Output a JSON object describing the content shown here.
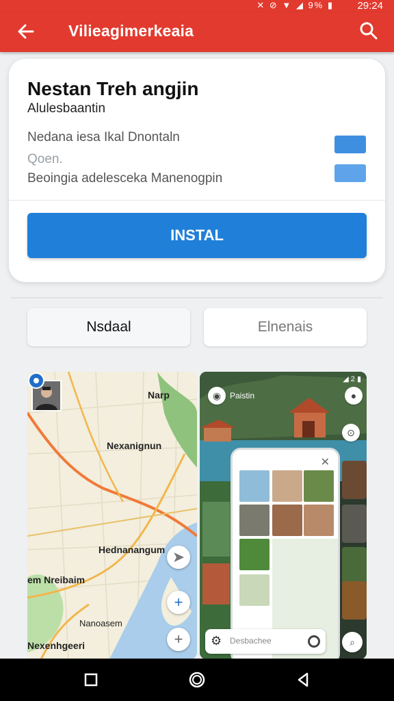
{
  "status": {
    "time": "29:24",
    "icons": "✕ ⊘ ▼ ◢ 9% ▮"
  },
  "appbar": {
    "title": "Vilieagimerkeaia",
    "back_icon": "arrow-left-icon",
    "search_icon": "search-icon"
  },
  "card": {
    "title": "Nestan Treh angjin",
    "subtitle": "Alulesbaantin",
    "rows": [
      "Nedana iesa Ikal Dnontaln",
      "Qoen.",
      "Beoingia adelesceka Manenogpin"
    ],
    "colors": {
      "swatch1": "#3f8fe0",
      "swatch2": "#5fa4ea"
    },
    "install_label": "INSTAL",
    "install_color": "#1f7fd9"
  },
  "tabs": [
    {
      "label": "Nsdaal"
    },
    {
      "label": "Elnenais"
    }
  ],
  "screenshot1": {
    "labels": [
      "Narp",
      "Nexanignun",
      "Hednanangum",
      "em Nreibaim",
      "Nanoasem",
      "Nexenhgeeri"
    ]
  },
  "screenshot2": {
    "search_text": "Desbachee",
    "top_text": "Paistin",
    "status": "◢ 2 ▮"
  },
  "theme": {
    "primary": "#e23a2e",
    "accent": "#1f7fd9"
  }
}
